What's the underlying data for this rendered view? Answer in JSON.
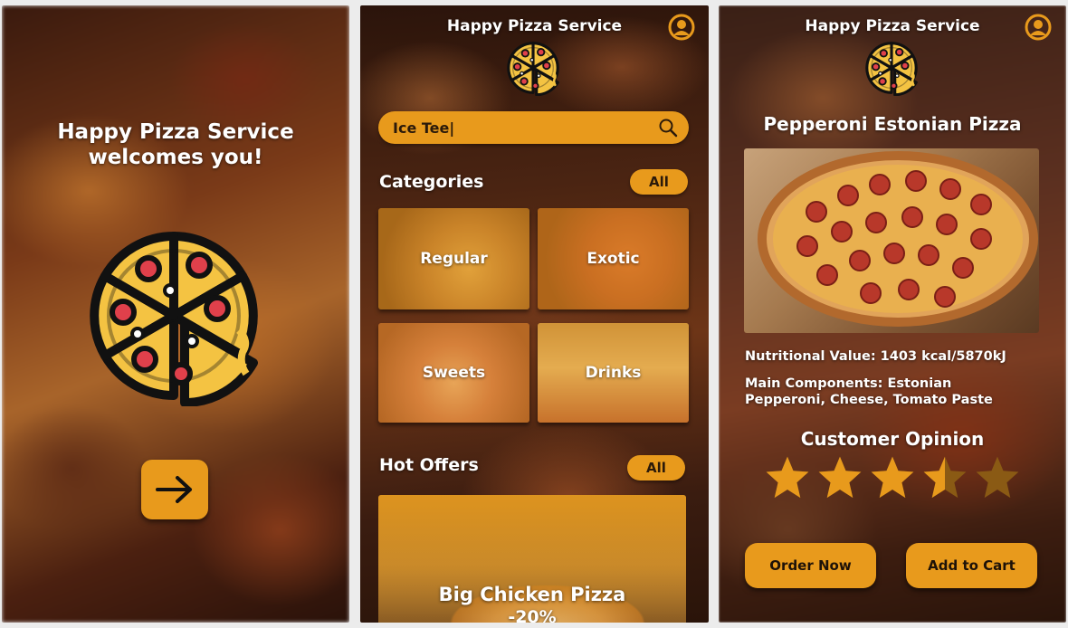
{
  "app_name": "Happy Pizza Service",
  "welcome": {
    "title_line1": "Happy Pizza Service",
    "title_line2": "welcomes you!",
    "next_icon": "arrow-right-icon"
  },
  "home": {
    "header_title": "Happy Pizza Service",
    "search": {
      "value": "Ice Tee|",
      "icon": "search-icon"
    },
    "categories": {
      "title": "Categories",
      "all_label": "All",
      "items": [
        {
          "label": "Regular"
        },
        {
          "label": "Exotic"
        },
        {
          "label": "Sweets"
        },
        {
          "label": "Drinks"
        }
      ]
    },
    "hot_offers": {
      "title": "Hot Offers",
      "all_label": "All",
      "offer_title": "Big Chicken Pizza",
      "offer_discount": "-20%"
    }
  },
  "product": {
    "header_title": "Happy Pizza Service",
    "name": "Pepperoni Estonian Pizza",
    "nutrition": "Nutritional Value: 1403 kcal/5870kJ",
    "components_line1": "Main Components: Estonian",
    "components_line2": "Pepperoni, Cheese, Tomato Paste",
    "opinion_title": "Customer Opinion",
    "rating": 3.5,
    "rating_max": 5,
    "order_label": "Order Now",
    "cart_label": "Add to Cart"
  },
  "colors": {
    "accent": "#e89a1c",
    "text_dark": "#2b1a0a",
    "star": "#e89a1c"
  }
}
